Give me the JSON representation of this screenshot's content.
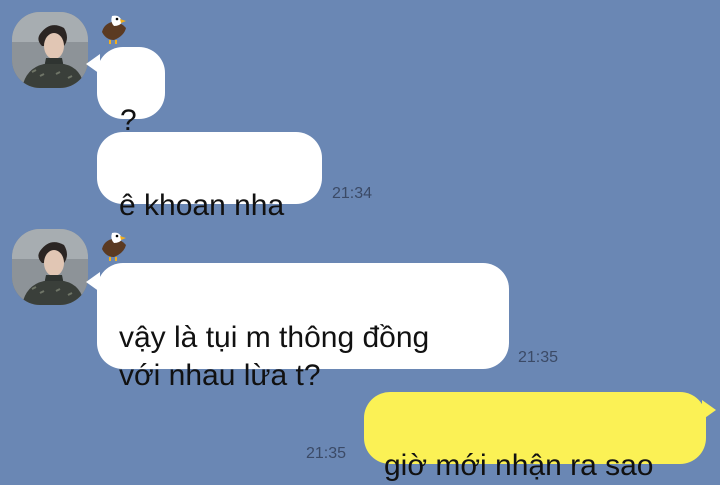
{
  "chat": {
    "messages": [
      {
        "sender": "other",
        "text": "?"
      },
      {
        "sender": "other",
        "text": "ê khoan nha",
        "time": "21:34"
      },
      {
        "sender": "other",
        "text": "vậy là tụi m thông đồng\nvới nhau lừa t?",
        "time": "21:35"
      },
      {
        "sender": "me",
        "text": "giờ mới nhận ra sao",
        "time": "21:35"
      }
    ],
    "contact": {
      "avatar_icon": "user-photo-icon",
      "name_icon": "eagle-emoji-icon"
    }
  },
  "colors": {
    "background": "#6a87b4",
    "incoming_bubble": "#ffffff",
    "outgoing_bubble": "#fbf155",
    "timestamp": "#3b4a66"
  }
}
